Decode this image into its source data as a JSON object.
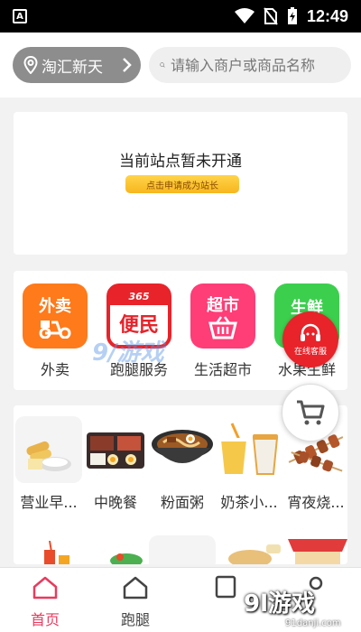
{
  "status_bar": {
    "time": "12:49"
  },
  "header": {
    "location": "淘汇新天",
    "search_placeholder": "请输入商户或商品名称"
  },
  "notice": {
    "message": "当前站点暂未开通",
    "apply_button": "点击申请成为站长"
  },
  "services": [
    {
      "label": "外卖",
      "icon_text": "外卖",
      "icon": "scooter-icon",
      "color": "#ff7a1a"
    },
    {
      "label": "跑腿服务",
      "icon_text": "便民",
      "icon_badge": "365",
      "icon": "calendar-icon",
      "color": "#e8232a"
    },
    {
      "label": "生活超市",
      "icon_text": "超市",
      "icon": "basket-icon",
      "color": "#ff3d77"
    },
    {
      "label": "水果生鲜",
      "icon_text": "生鲜",
      "icon": "fruit-icon",
      "color": "#3ccf4e"
    }
  ],
  "categories": [
    {
      "label": "营业早...",
      "icon": "breakfast-icon"
    },
    {
      "label": "中晚餐",
      "icon": "bento-icon"
    },
    {
      "label": "粉面粥",
      "icon": "noodle-bowl-icon"
    },
    {
      "label": "奶茶小...",
      "icon": "milk-tea-icon"
    },
    {
      "label": "宵夜烧...",
      "icon": "skewer-icon"
    }
  ],
  "floating": {
    "customer_service": "在线客服",
    "cart_icon": "cart-icon"
  },
  "tabbar": {
    "tabs": [
      {
        "label": "首页",
        "icon": "home-icon",
        "active": true
      },
      {
        "label": "跑腿",
        "icon": "house-icon",
        "active": false
      }
    ]
  },
  "watermark": {
    "center": "9/游戏",
    "brand": "9l游戏",
    "domain": "91danji.com"
  },
  "colors": {
    "accent": "#e83b5e",
    "location_pill": "#8d8d8d",
    "notice_button": "#f7b61e"
  }
}
